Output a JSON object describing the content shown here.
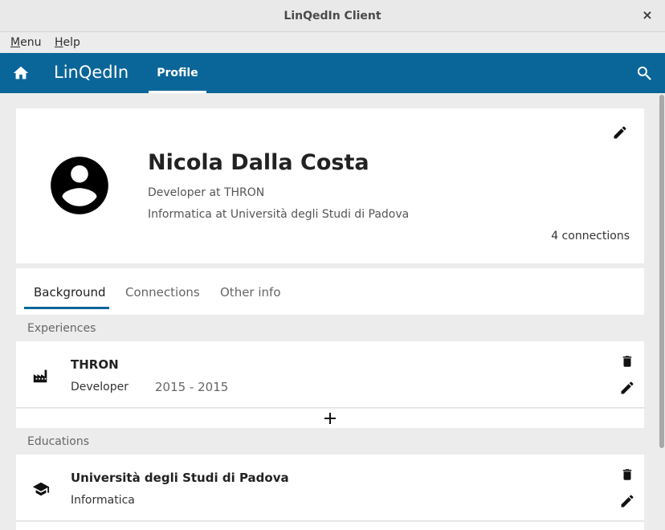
{
  "window": {
    "title": "LinQedIn Client",
    "close_glyph": "×"
  },
  "menubar": {
    "menu_rest": "enu",
    "menu_hot": "M",
    "help_hot": "H",
    "help_rest": "elp"
  },
  "appbar": {
    "brand": "LinQedIn",
    "active_tab": "Profile",
    "color": "#0a6699"
  },
  "profile": {
    "name": "Nicola Dalla Costa",
    "job": "Developer at THRON",
    "education": "Informatica at Università degli Studi di Padova",
    "connections": "4 connections"
  },
  "tabs": [
    {
      "label": "Background",
      "active": true
    },
    {
      "label": "Connections",
      "active": false
    },
    {
      "label": "Other info",
      "active": false
    }
  ],
  "experiences": {
    "label": "Experiences",
    "items": [
      {
        "title": "THRON",
        "role": "Developer",
        "dates": "2015 - 2015",
        "icon": "factory-icon"
      }
    ]
  },
  "educations": {
    "label": "Educations",
    "items": [
      {
        "title": "Università degli Studi di Padova",
        "field": "Informatica",
        "icon": "graduation-cap-icon"
      }
    ]
  },
  "icons": [
    "home-icon",
    "search-icon",
    "account-circle-icon",
    "pencil-icon",
    "trash-icon",
    "plus-icon"
  ]
}
